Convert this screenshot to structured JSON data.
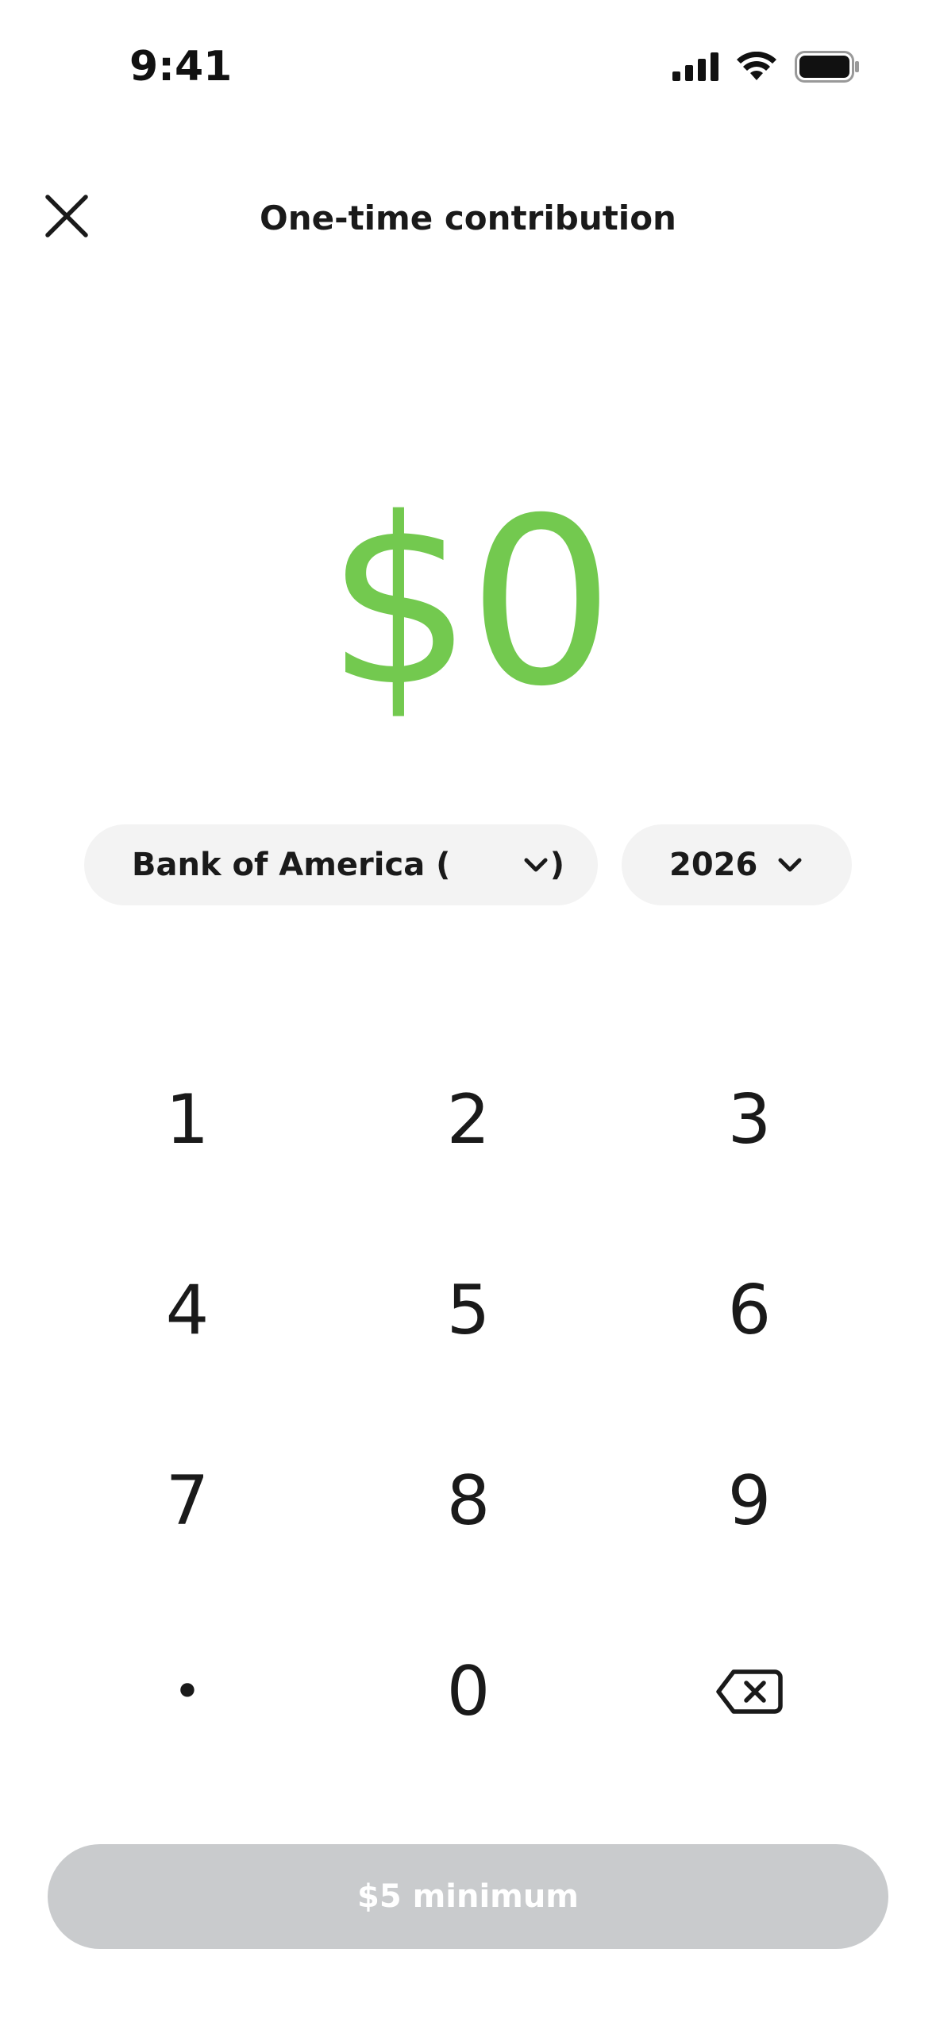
{
  "status_bar": {
    "time": "9:41",
    "icons": [
      "cellular-signal-icon",
      "wifi-icon",
      "battery-icon"
    ]
  },
  "header": {
    "title": "One-time contribution",
    "close_icon": "close-icon"
  },
  "amount": {
    "value": "$0",
    "color": "#73c94f"
  },
  "selectors": {
    "account": {
      "label": "Bank of America (         )",
      "icon": "chevron-down-icon"
    },
    "year": {
      "label": "2026",
      "icon": "chevron-down-icon"
    }
  },
  "keypad": {
    "keys": [
      "1",
      "2",
      "3",
      "4",
      "5",
      "6",
      "7",
      "8",
      "9",
      "•",
      "0"
    ],
    "backspace_icon": "backspace-icon"
  },
  "submit": {
    "label": "$5 minimum",
    "background": "#c9cbcd"
  }
}
